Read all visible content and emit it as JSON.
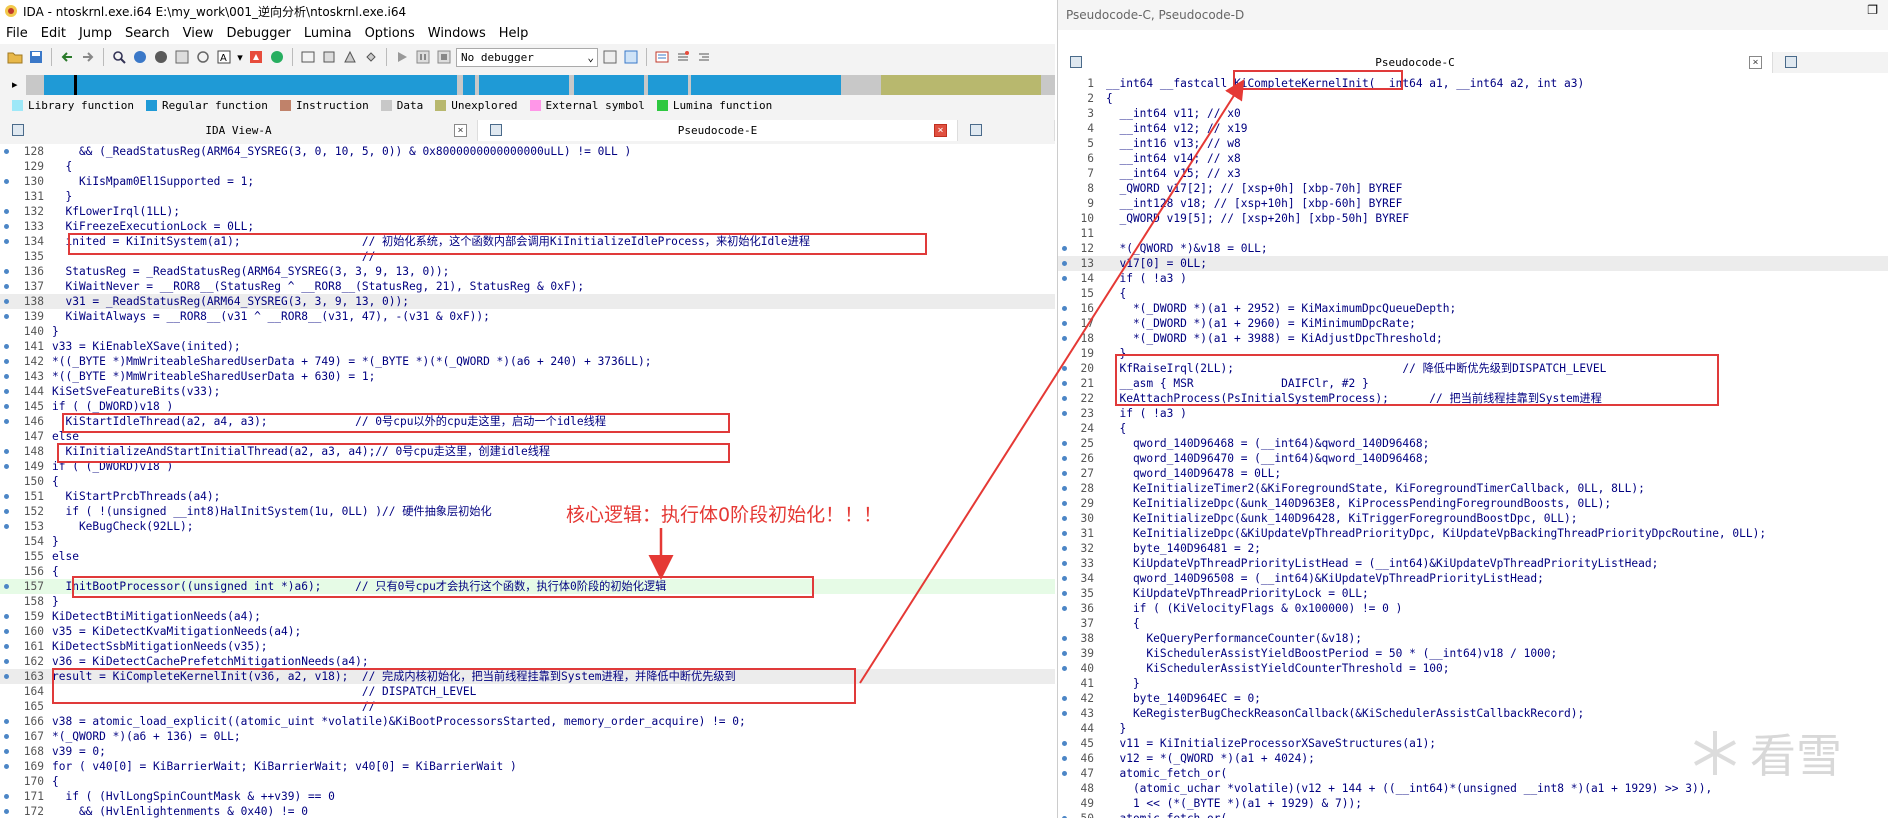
{
  "window": {
    "title": "IDA - ntoskrnl.exe.i64 E:\\my_work\\001_逆向分析\\ntoskrnl.exe.i64"
  },
  "menu": [
    "File",
    "Edit",
    "Jump",
    "Search",
    "View",
    "Debugger",
    "Lumina",
    "Options",
    "Windows",
    "Help"
  ],
  "toolbar": {
    "debugger": "No debugger"
  },
  "legend": [
    {
      "label": "Library function",
      "color": "#9ee8f8"
    },
    {
      "label": "Regular function",
      "color": "#1f9ad6"
    },
    {
      "label": "Instruction",
      "color": "#c0826a"
    },
    {
      "label": "Data",
      "color": "#c8c8c8"
    },
    {
      "label": "Unexplored",
      "color": "#b8b86e"
    },
    {
      "label": "External symbol",
      "color": "#ff96e8"
    },
    {
      "label": "Lumina function",
      "color": "#2ec840"
    }
  ],
  "left_tabs": [
    {
      "label": "IDA View-A"
    },
    {
      "label": "Pseudocode-E"
    }
  ],
  "right_window": {
    "title": "Pseudocode-C, Pseudocode-D",
    "tab": "Pseudocode-C"
  },
  "annotation": "核心逻辑：执行体0阶段初始化！！！",
  "watermark": "看雪",
  "left_code": [
    {
      "n": "128",
      "d": true,
      "t": "    && (_ReadStatusReg(ARM64_SYSREG(3, 0, 10, 5, 0)) & 0x8000000000000000uLL) != 0LL )"
    },
    {
      "n": "129",
      "d": false,
      "t": "  {"
    },
    {
      "n": "130",
      "d": true,
      "t": "    KiIsMpam0El1Supported = 1;"
    },
    {
      "n": "131",
      "d": false,
      "t": "  }"
    },
    {
      "n": "132",
      "d": true,
      "t": "  KfLowerIrql(1LL);"
    },
    {
      "n": "133",
      "d": true,
      "t": "  KiFreezeExecutionLock = 0LL;"
    },
    {
      "n": "134",
      "d": true,
      "t": "  inited = KiInitSystem(a1);                  // 初始化系统，这个函数内部会调用KiInitializeIdleProcess，来初始化Idle进程"
    },
    {
      "n": "135",
      "d": false,
      "t": "                                              //"
    },
    {
      "n": "136",
      "d": true,
      "t": "  StatusReg = _ReadStatusReg(ARM64_SYSREG(3, 3, 9, 13, 0));"
    },
    {
      "n": "137",
      "d": true,
      "t": "  KiWaitNever = __ROR8__(StatusReg ^ __ROR8__(StatusReg, 21), StatusReg & 0xF);"
    },
    {
      "n": "138",
      "d": true,
      "t": "  v31 = _ReadStatusReg(ARM64_SYSREG(3, 3, 9, 13, 0));",
      "hl": "g"
    },
    {
      "n": "139",
      "d": true,
      "t": "  KiWaitAlways = __ROR8__(v31 ^ __ROR8__(v31, 47), -(v31 & 0xF));"
    },
    {
      "n": "140",
      "d": false,
      "t": "}"
    },
    {
      "n": "141",
      "d": true,
      "t": "v33 = KiEnableXSave(inited);"
    },
    {
      "n": "142",
      "d": true,
      "t": "*((_BYTE *)MmWriteableSharedUserData + 749) = *(_BYTE *)(*(_QWORD *)(a6 + 240) + 3736LL);"
    },
    {
      "n": "143",
      "d": true,
      "t": "*((_BYTE *)MmWriteableSharedUserData + 630) = 1;"
    },
    {
      "n": "144",
      "d": true,
      "t": "KiSetSveFeatureBits(v33);"
    },
    {
      "n": "145",
      "d": true,
      "t": "if ( (_DWORD)v18 )"
    },
    {
      "n": "146",
      "d": true,
      "t": "  KiStartIdleThread(a2, a4, a3);             // 0号cpu以外的cpu走这里，启动一个idle线程"
    },
    {
      "n": "147",
      "d": false,
      "t": "else"
    },
    {
      "n": "148",
      "d": true,
      "t": "  KiInitializeAndStartInitialThread(a2, a3, a4);// 0号cpu走这里，创建idle线程"
    },
    {
      "n": "149",
      "d": true,
      "t": "if ( (_DWORD)v18 )"
    },
    {
      "n": "150",
      "d": false,
      "t": "{"
    },
    {
      "n": "151",
      "d": true,
      "t": "  KiStartPrcbThreads(a4);"
    },
    {
      "n": "152",
      "d": true,
      "t": "  if ( !(unsigned __int8)HalInitSystem(1u, 0LL) )// 硬件抽象层初始化"
    },
    {
      "n": "153",
      "d": true,
      "t": "    KeBugCheck(92LL);"
    },
    {
      "n": "154",
      "d": false,
      "t": "}"
    },
    {
      "n": "155",
      "d": false,
      "t": "else"
    },
    {
      "n": "156",
      "d": false,
      "t": "{"
    },
    {
      "n": "157",
      "d": true,
      "t": "  InitBootProcessor((unsigned int *)a6);     // 只有0号cpu才会执行这个函数，执行体0阶段的初始化逻辑",
      "hl": "g2"
    },
    {
      "n": "158",
      "d": false,
      "t": "}"
    },
    {
      "n": "159",
      "d": true,
      "t": "KiDetectBtiMitigationNeeds(a4);"
    },
    {
      "n": "160",
      "d": true,
      "t": "v35 = KiDetectKvaMitigationNeeds(a4);"
    },
    {
      "n": "161",
      "d": true,
      "t": "KiDetectSsbMitigationNeeds(v35);"
    },
    {
      "n": "162",
      "d": true,
      "t": "v36 = KiDetectCachePrefetchMitigationNeeds(a4);"
    },
    {
      "n": "163",
      "d": true,
      "t": "result = KiCompleteKernelInit(v36, a2, v18);  // 完成内核初始化，把当前线程挂靠到System进程，并降低中断优先级到",
      "hl": "g"
    },
    {
      "n": "164",
      "d": false,
      "t": "                                              // DISPATCH_LEVEL"
    },
    {
      "n": "165",
      "d": false,
      "t": "                                              //"
    },
    {
      "n": "166",
      "d": true,
      "t": "v38 = atomic_load_explicit((atomic_uint *volatile)&KiBootProcessorsStarted, memory_order_acquire) != 0;"
    },
    {
      "n": "167",
      "d": true,
      "t": "*(_QWORD *)(a6 + 136) = 0LL;"
    },
    {
      "n": "168",
      "d": true,
      "t": "v39 = 0;"
    },
    {
      "n": "169",
      "d": true,
      "t": "for ( v40[0] = KiBarrierWait; KiBarrierWait; v40[0] = KiBarrierWait )"
    },
    {
      "n": "170",
      "d": false,
      "t": "{"
    },
    {
      "n": "171",
      "d": true,
      "t": "  if ( (HvlLongSpinCountMask & ++v39) == 0"
    },
    {
      "n": "172",
      "d": true,
      "t": "    && (HvlEnlightenments & 0x40) != 0"
    }
  ],
  "right_code": [
    {
      "n": "1",
      "d": false,
      "t": "__int64 __fastcall KiCompleteKernelInit(__int64 a1, __int64 a2, int a3)"
    },
    {
      "n": "2",
      "d": false,
      "t": "{"
    },
    {
      "n": "3",
      "d": false,
      "t": "  __int64 v11; // x0"
    },
    {
      "n": "4",
      "d": false,
      "t": "  __int64 v12; // x19"
    },
    {
      "n": "5",
      "d": false,
      "t": "  __int16 v13; // w8"
    },
    {
      "n": "6",
      "d": false,
      "t": "  __int64 v14; // x8"
    },
    {
      "n": "7",
      "d": false,
      "t": "  __int64 v15; // x3"
    },
    {
      "n": "8",
      "d": false,
      "t": "  _QWORD v17[2]; // [xsp+0h] [xbp-70h] BYREF"
    },
    {
      "n": "9",
      "d": false,
      "t": "  __int128 v18; // [xsp+10h] [xbp-60h] BYREF"
    },
    {
      "n": "10",
      "d": false,
      "t": "  _QWORD v19[5]; // [xsp+20h] [xbp-50h] BYREF"
    },
    {
      "n": "11",
      "d": false,
      "t": ""
    },
    {
      "n": "12",
      "d": true,
      "t": "  *(_QWORD *)&v18 = 0LL;"
    },
    {
      "n": "13",
      "d": true,
      "t": "  v17[0] = 0LL;",
      "hl": "g"
    },
    {
      "n": "14",
      "d": true,
      "t": "  if ( !a3 )"
    },
    {
      "n": "15",
      "d": false,
      "t": "  {"
    },
    {
      "n": "16",
      "d": true,
      "t": "    *(_DWORD *)(a1 + 2952) = KiMaximumDpcQueueDepth;"
    },
    {
      "n": "17",
      "d": true,
      "t": "    *(_DWORD *)(a1 + 2960) = KiMinimumDpcRate;"
    },
    {
      "n": "18",
      "d": true,
      "t": "    *(_DWORD *)(a1 + 3988) = KiAdjustDpcThreshold;"
    },
    {
      "n": "19",
      "d": false,
      "t": "  }"
    },
    {
      "n": "20",
      "d": true,
      "t": "  KfRaiseIrql(2LL);                         // 降低中断优先级到DISPATCH_LEVEL"
    },
    {
      "n": "21",
      "d": true,
      "t": "  __asm { MSR             DAIFClr, #2 }"
    },
    {
      "n": "22",
      "d": true,
      "t": "  KeAttachProcess(PsInitialSystemProcess);      // 把当前线程挂靠到System进程"
    },
    {
      "n": "23",
      "d": true,
      "t": "  if ( !a3 )"
    },
    {
      "n": "24",
      "d": false,
      "t": "  {"
    },
    {
      "n": "25",
      "d": true,
      "t": "    qword_140D96468 = (__int64)&qword_140D96468;"
    },
    {
      "n": "26",
      "d": true,
      "t": "    qword_140D96470 = (__int64)&qword_140D96468;"
    },
    {
      "n": "27",
      "d": true,
      "t": "    qword_140D96478 = 0LL;"
    },
    {
      "n": "28",
      "d": true,
      "t": "    KeInitializeTimer2(&KiForegroundState, KiForegroundTimerCallback, 0LL, 8LL);"
    },
    {
      "n": "29",
      "d": true,
      "t": "    KeInitializeDpc(&unk_140D963E8, KiProcessPendingForegroundBoosts, 0LL);"
    },
    {
      "n": "30",
      "d": true,
      "t": "    KeInitializeDpc(&unk_140D96428, KiTriggerForegroundBoostDpc, 0LL);"
    },
    {
      "n": "31",
      "d": true,
      "t": "    KeInitializeDpc(&KiUpdateVpThreadPriorityDpc, KiUpdateVpBackingThreadPriorityDpcRoutine, 0LL);"
    },
    {
      "n": "32",
      "d": true,
      "t": "    byte_140D96481 = 2;"
    },
    {
      "n": "33",
      "d": true,
      "t": "    KiUpdateVpThreadPriorityListHead = (__int64)&KiUpdateVpThreadPriorityListHead;"
    },
    {
      "n": "34",
      "d": true,
      "t": "    qword_140D96508 = (__int64)&KiUpdateVpThreadPriorityListHead;"
    },
    {
      "n": "35",
      "d": true,
      "t": "    KiUpdateVpThreadPriorityLock = 0LL;"
    },
    {
      "n": "36",
      "d": true,
      "t": "    if ( (KiVelocityFlags & 0x100000) != 0 )"
    },
    {
      "n": "37",
      "d": false,
      "t": "    {"
    },
    {
      "n": "38",
      "d": true,
      "t": "      KeQueryPerformanceCounter(&v18);"
    },
    {
      "n": "39",
      "d": true,
      "t": "      KiSchedulerAssistYieldBoostPeriod = 50 * (__int64)v18 / 1000;"
    },
    {
      "n": "40",
      "d": true,
      "t": "      KiSchedulerAssistYieldCounterThreshold = 100;"
    },
    {
      "n": "41",
      "d": false,
      "t": "    }"
    },
    {
      "n": "42",
      "d": true,
      "t": "    byte_140D964EC = 0;"
    },
    {
      "n": "43",
      "d": true,
      "t": "    KeRegisterBugCheckReasonCallback(&KiSchedulerAssistCallbackRecord);"
    },
    {
      "n": "44",
      "d": false,
      "t": "  }"
    },
    {
      "n": "45",
      "d": true,
      "t": "  v11 = KiInitializeProcessorXSaveStructures(a1);"
    },
    {
      "n": "46",
      "d": true,
      "t": "  v12 = *(_QWORD *)(a1 + 4024);"
    },
    {
      "n": "47",
      "d": true,
      "t": "  atomic_fetch_or("
    },
    {
      "n": "48",
      "d": false,
      "t": "    (atomic_uchar *volatile)(v12 + 144 + ((__int64)*(unsigned __int8 *)(a1 + 1929) >> 3)),"
    },
    {
      "n": "49",
      "d": false,
      "t": "    1 << (*(_BYTE *)(a1 + 1929) & 7));"
    },
    {
      "n": "50",
      "d": true,
      "t": "  atomic_fetch_or("
    }
  ]
}
